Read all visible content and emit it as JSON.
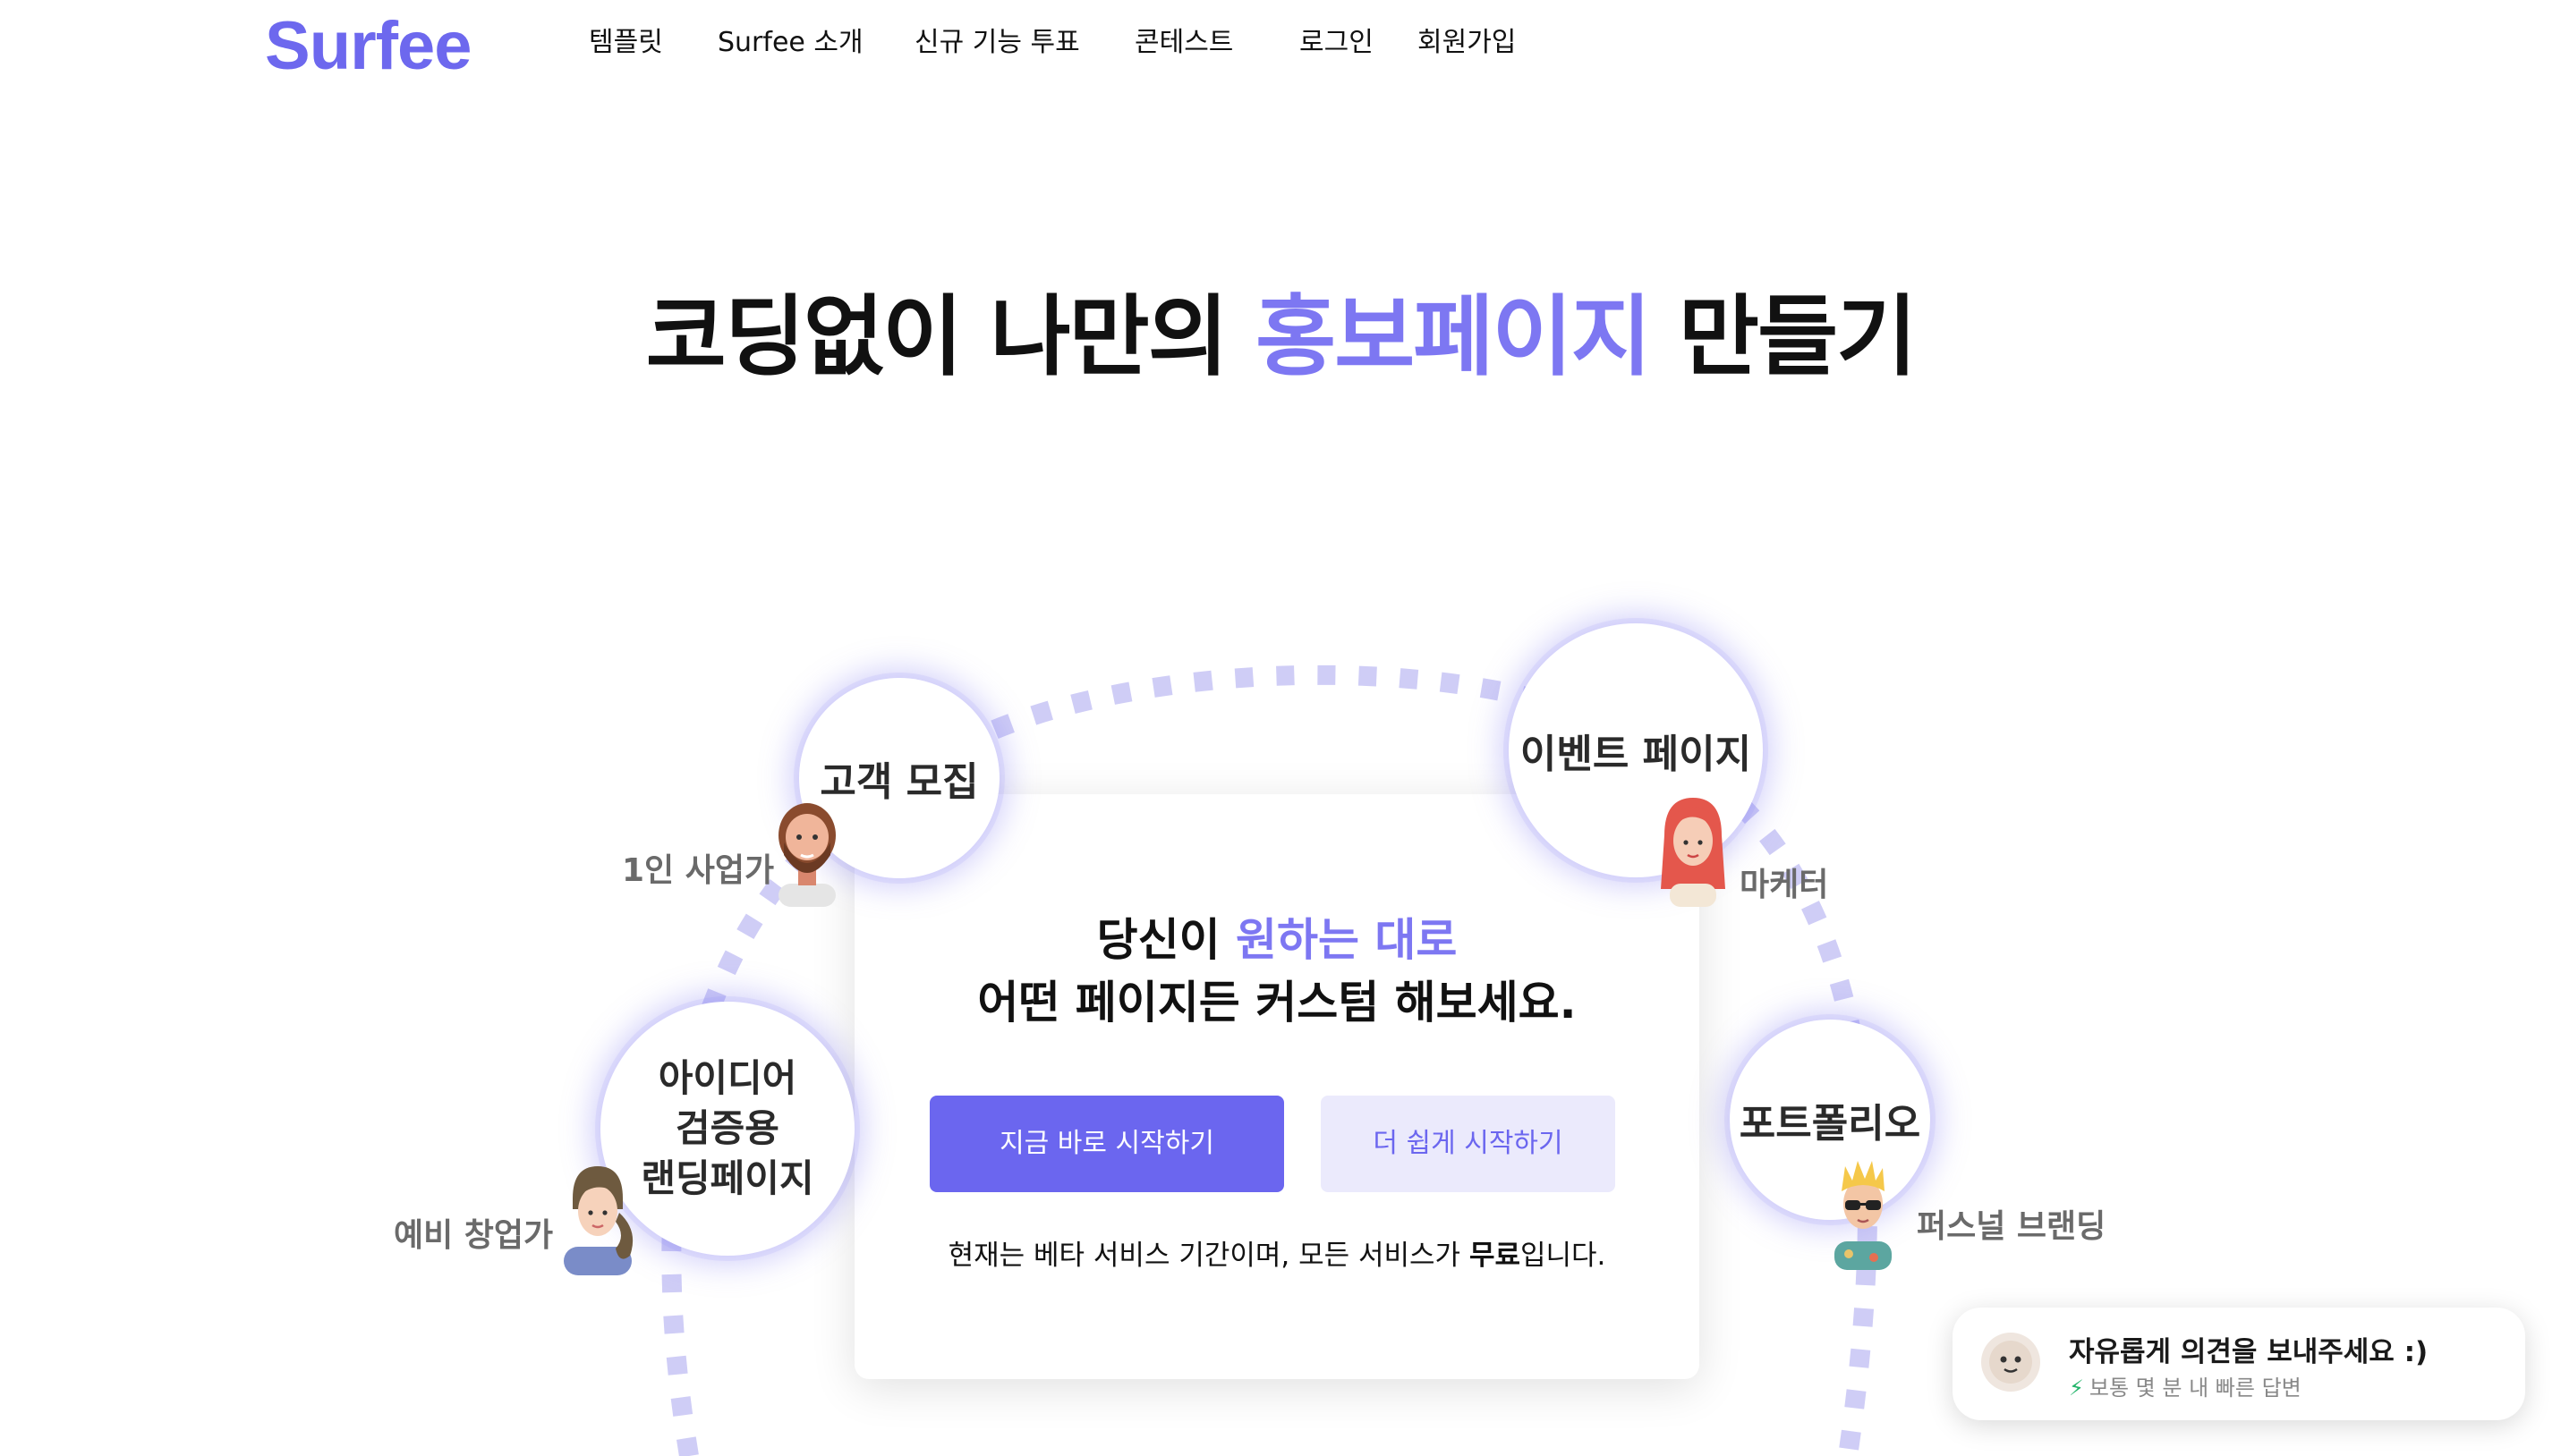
{
  "header": {
    "logo": "Surfee",
    "nav": [
      "템플릿",
      "Surfee 소개",
      "신규 기능 투표",
      "콘테스트",
      "로그인",
      "회원가입"
    ]
  },
  "hero": {
    "title_before": "코딩없이 나만의 ",
    "title_accent": "홍보페이지",
    "title_after": " 만들기"
  },
  "card": {
    "line1_before": "당신이 ",
    "line1_accent": "원하는 대로",
    "line2": "어떤 페이지든 커스텀 해보세요.",
    "primary_button": "지금 바로 시작하기",
    "secondary_button": "더 쉽게 시작하기",
    "notice_before": "현재는 베타 서비스 기간이며, 모든 서비스가 ",
    "notice_bold": "무료",
    "notice_after": "입니다."
  },
  "bubbles": {
    "customer": "고객 모집",
    "event": "이벤트 페이지",
    "idea_1": "아이디어",
    "idea_2": "검증용",
    "idea_3": "랜딩페이지",
    "portfolio": "포트폴리오"
  },
  "roles": {
    "solo": "1인 사업가",
    "marketer": "마케터",
    "founder": "예비 창업가",
    "personal": "퍼스널 브랜딩"
  },
  "avatars": [
    "bearded-man-avatar",
    "red-hair-woman-avatar",
    "ponytail-woman-avatar",
    "sunglasses-man-avatar"
  ],
  "feedback": {
    "title": "자유롭게 의견을 보내주세요 :)",
    "sub": "보통 몇 분 내 빠른 답변",
    "icon": "lightning-icon"
  },
  "colors": {
    "accent": "#6d68ee",
    "accent_light": "#ebeafc",
    "quick_reply": "#22b46a"
  }
}
